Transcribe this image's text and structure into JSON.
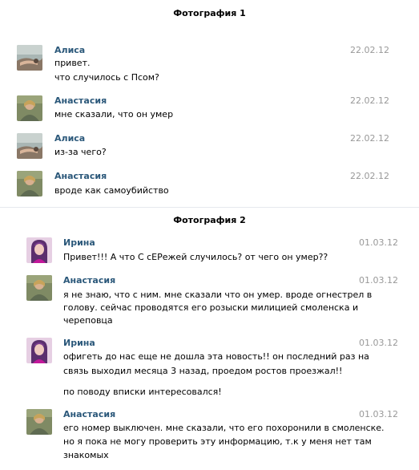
{
  "sections": [
    {
      "title": "Фотография 1",
      "messages": [
        {
          "author": "Алиса",
          "date": "22.02.12",
          "avatar": "alisa-avatar",
          "lines": [
            "привет.",
            "что случилось с Псом?"
          ]
        },
        {
          "author": "Анастасия",
          "date": "22.02.12",
          "avatar": "anastasia-avatar",
          "lines": [
            "мне сказали, что он умер"
          ]
        },
        {
          "author": "Алиса",
          "date": "22.02.12",
          "avatar": "alisa-avatar",
          "lines": [
            "из-за чего?"
          ]
        },
        {
          "author": "Анастасия",
          "date": "22.02.12",
          "avatar": "anastasia-avatar",
          "lines": [
            "вроде как самоубийство"
          ]
        }
      ]
    },
    {
      "title": "Фотография 2",
      "messages": [
        {
          "author": "Ирина",
          "date": "01.03.12",
          "avatar": "irina-avatar",
          "lines": [
            "Привет!!! А что С сЕРежей случилось? от чего он умер??"
          ]
        },
        {
          "author": "Анастасия",
          "date": "01.03.12",
          "avatar": "anastasia-avatar",
          "lines": [
            "я не знаю, что с ним. мне сказали что он умер. вроде огнестрел в",
            "голову. сейчас проводятся его розыски милицией смоленска и",
            "череповца"
          ]
        },
        {
          "author": "Ирина",
          "date": "01.03.12",
          "avatar": "irina-avatar",
          "lines": [
            "офигеть до нас еще не дошла эта новость!! он последний раз на",
            "связь выходил месяца 3 назад, проедом ростов проезжал!!",
            "по поводу вписки интересовался!"
          ]
        },
        {
          "author": "Анастасия",
          "date": "01.03.12",
          "avatar": "anastasia-avatar",
          "lines": [
            "его номер выключен. мне сказали, что его похоронили в смоленске.",
            "но я пока не могу проверить эту информацию, т.к у меня нет там",
            "знакомых"
          ]
        }
      ]
    }
  ],
  "colors": {
    "author": "#2b587a",
    "date": "#999999",
    "divider": "#e6e9ee"
  }
}
